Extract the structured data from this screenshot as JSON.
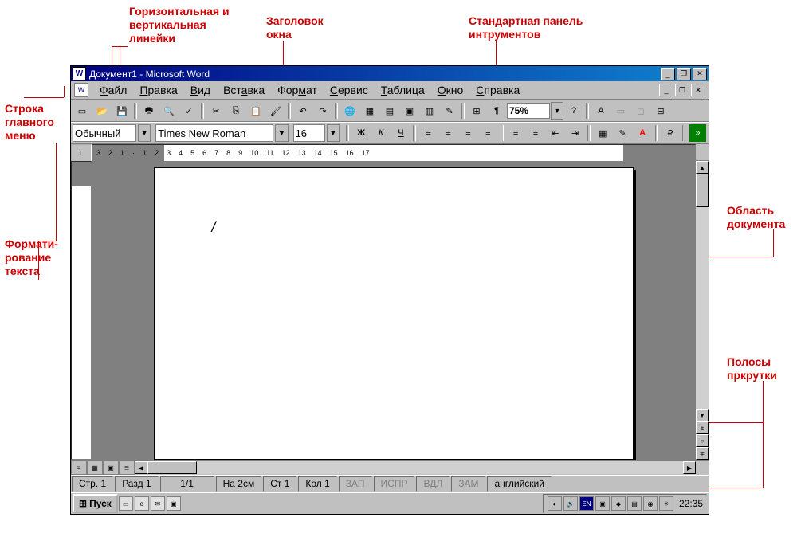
{
  "callouts": {
    "rulers": "Горизонтальная и\nвертикальная\nлинейки",
    "title": "Заголовок\nокна",
    "std_toolbar": "Стандартная панель\nинтрументов",
    "main_menu": "Строка\nглавного\nменю",
    "formatting": "Формати-\nрование\nтекста",
    "doc_area": "Область\nдокумента",
    "scrollbars": "Полосы\nпркрутки"
  },
  "titlebar": {
    "title": "Документ1 - Microsoft Word"
  },
  "menu": {
    "items": [
      "Файл",
      "Правка",
      "Вид",
      "Вставка",
      "Формат",
      "Сервис",
      "Таблица",
      "Окно",
      "Справка"
    ]
  },
  "toolbar": {
    "zoom": "75%",
    "icons": [
      "new",
      "open",
      "save",
      "mail",
      "print",
      "preview",
      "spell",
      "cut",
      "copy",
      "paste",
      "format-painter",
      "undo",
      "redo",
      "hyperlink",
      "tables",
      "insert-table",
      "excel",
      "columns",
      "drawing",
      "doc-map",
      "show-para",
      "zoom",
      "help",
      "wordart",
      "form",
      "frame",
      "group"
    ]
  },
  "format_toolbar": {
    "style": "Обычный",
    "font": "Times New Roman",
    "size": "16",
    "bold": "Ж",
    "italic": "К",
    "underline": "Ч"
  },
  "ruler": {
    "ticks": [
      "3",
      "2",
      "1",
      "",
      "1",
      "2",
      "3",
      "4",
      "5",
      "6",
      "7",
      "8",
      "9",
      "10",
      "11",
      "12",
      "13",
      "14",
      "15",
      "16",
      "17"
    ]
  },
  "status": {
    "page": "Стр. 1",
    "section": "Разд 1",
    "pages": "1/1",
    "at": "На 2см",
    "line": "Ст 1",
    "col": "Кол 1",
    "rec": "ЗАП",
    "trk": "ИСПР",
    "ext": "ВДЛ",
    "ovr": "ЗАМ",
    "lang": "английский"
  },
  "taskbar": {
    "start": "Пуск",
    "time": "22:35"
  }
}
